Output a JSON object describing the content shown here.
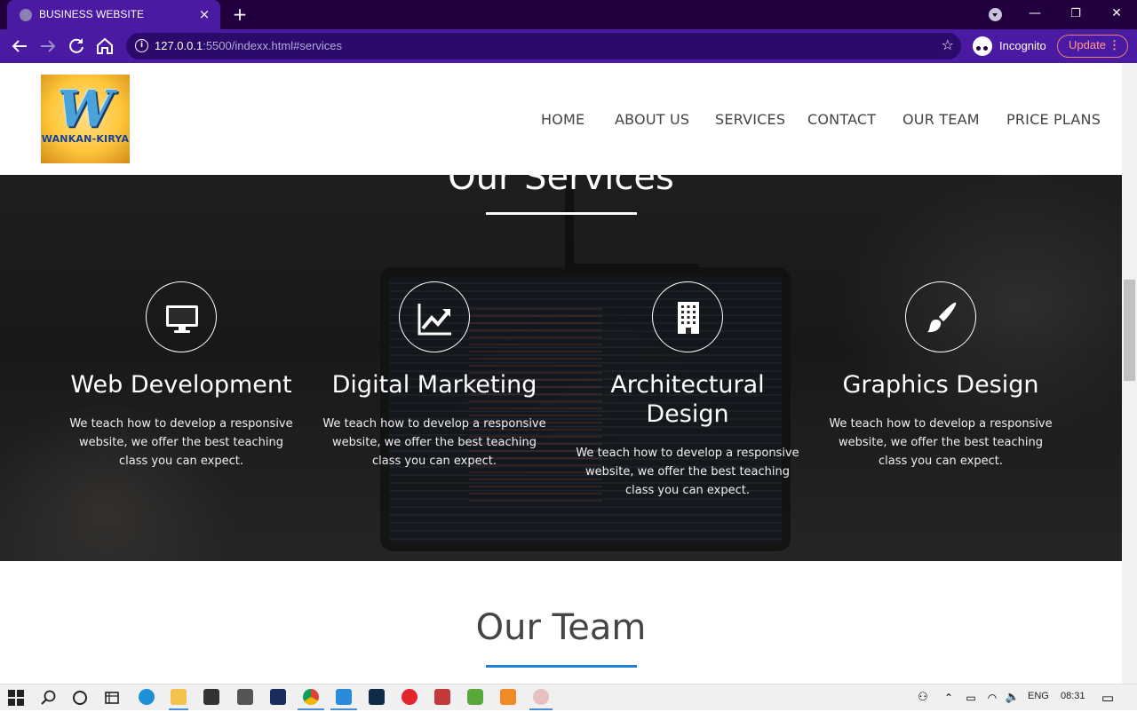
{
  "browser": {
    "tab_title": "BUSINESS WEBSITE",
    "tab_close": "×",
    "new_tab": "+",
    "url_host": "127.0.0.1",
    "url_rest": ":5500/indexx.html#services",
    "profile_label": "Incognito",
    "update_label": "Update",
    "window_controls": {
      "minimize": "—",
      "restore": "❐",
      "close": "✕"
    }
  },
  "site": {
    "logo_letter": "W",
    "logo_text": "WANKAN-KIRYA",
    "nav": [
      "HOME",
      "ABOUT US",
      "SERVICES",
      "CONTACT",
      "OUR TEAM",
      "PRICE PLANS"
    ]
  },
  "services": {
    "title": "Our Services",
    "cards": [
      {
        "title": "Web Development",
        "icon": "desktop-icon",
        "text": "We teach how to develop a responsive website, we offer the best teaching class you can expect."
      },
      {
        "title": "Digital Marketing",
        "icon": "chart-line-icon",
        "text": "We teach how to develop a responsive website, we offer the best teaching class you can expect."
      },
      {
        "title": "Architectural Design",
        "icon": "building-icon",
        "text": "We teach how to develop a responsive website, we offer the best teaching class you can expect."
      },
      {
        "title": "Graphics Design",
        "icon": "paint-brush-icon",
        "text": "We teach how to develop a responsive website, we offer the best teaching class you can expect."
      }
    ]
  },
  "team": {
    "title": "Our Team"
  },
  "taskbar": {
    "language": "ENG",
    "time": "08:31"
  }
}
